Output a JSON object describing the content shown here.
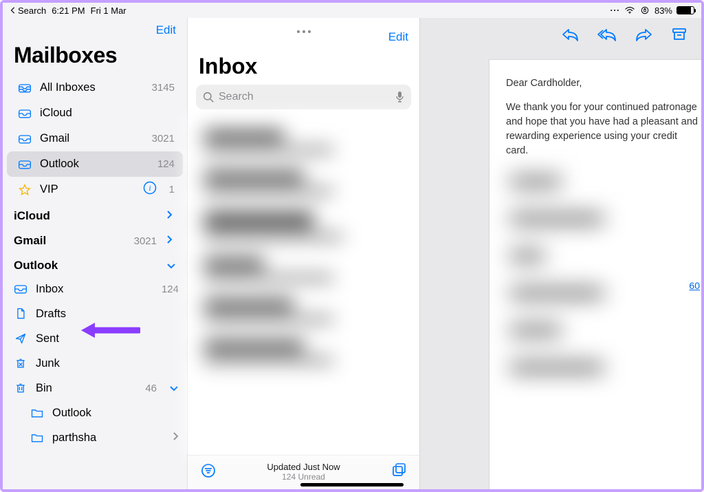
{
  "statusbar": {
    "back": "Search",
    "time": "6:21 PM",
    "date": "Fri 1 Mar",
    "battery": "83%"
  },
  "sidebar": {
    "edit": "Edit",
    "title": "Mailboxes",
    "items": [
      {
        "label": "All Inboxes",
        "count": "3145"
      },
      {
        "label": "iCloud",
        "count": ""
      },
      {
        "label": "Gmail",
        "count": "3021"
      },
      {
        "label": "Outlook",
        "count": "124"
      },
      {
        "label": "VIP",
        "count": "1"
      }
    ],
    "sections": {
      "icloud": {
        "label": "iCloud",
        "count": ""
      },
      "gmail": {
        "label": "Gmail",
        "count": "3021"
      },
      "outlook": {
        "label": "Outlook",
        "count": ""
      }
    },
    "outlook_children": {
      "inbox": {
        "label": "Inbox",
        "count": "124"
      },
      "drafts": {
        "label": "Drafts",
        "count": ""
      },
      "sent": {
        "label": "Sent",
        "count": ""
      },
      "junk": {
        "label": "Junk",
        "count": ""
      },
      "bin": {
        "label": "Bin",
        "count": "46"
      },
      "sub1": {
        "label": "Outlook"
      },
      "sub2": {
        "label": "parthsha"
      }
    }
  },
  "list": {
    "edit": "Edit",
    "title": "Inbox",
    "search_placeholder": "Search",
    "footer_line1": "Updated Just Now",
    "footer_line2": "124 Unread"
  },
  "message": {
    "greeting": "Dear Cardholder,",
    "body": "We thank you for your continued patronage and hope that you have had a pleasant and rewarding experience using your credit card."
  }
}
